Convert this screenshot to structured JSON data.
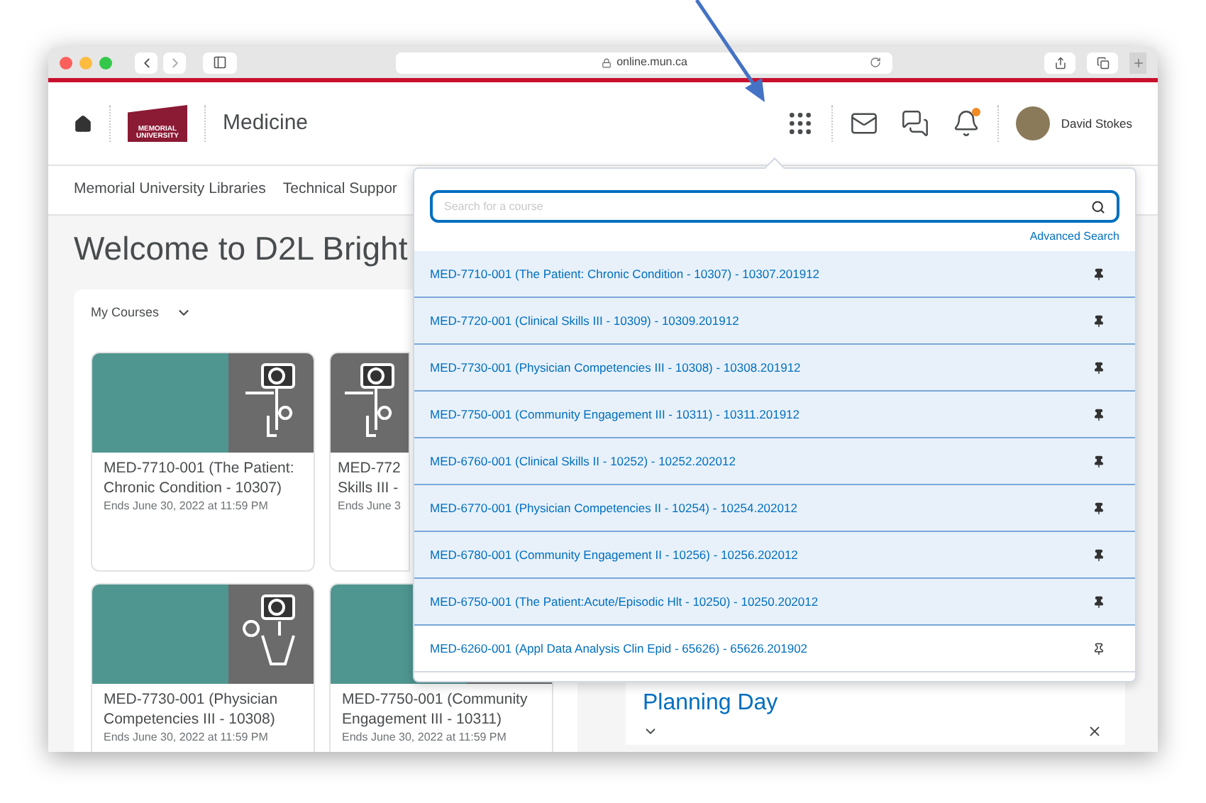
{
  "browser": {
    "url": "online.mun.ca"
  },
  "header": {
    "logo_text": [
      "MEMORIAL",
      "UNIVERSITY"
    ],
    "title": "Medicine",
    "has_new_notifications": true,
    "user": "David Stokes"
  },
  "nav": [
    "Memorial University Libraries",
    "Technical Suppor"
  ],
  "welcome": "Welcome to D2L Bright",
  "my_courses": {
    "label": "My Courses",
    "rows": [
      [
        {
          "title": "MED-7710-001 (The Patient: Chronic Condition - 10307)",
          "ends": "Ends June 30, 2022 at 11:59 PM",
          "partial": false
        },
        {
          "title": "MED-772\nSkills III -",
          "ends": "Ends June 3",
          "partial": true
        }
      ],
      [
        {
          "title": "MED-7730-001 (Physician Competencies III - 10308)",
          "ends": "Ends June 30, 2022 at 11:59 PM",
          "partial": false
        },
        {
          "title": "MED-7750-001 (Community Engagement III - 10311)",
          "ends": "Ends June 30, 2022 at 11:59 PM",
          "partial": false
        }
      ]
    ]
  },
  "course_selector": {
    "placeholder": "Search for a course",
    "advanced_search": "Advanced Search",
    "courses": [
      {
        "label": "MED-7710-001 (The Patient: Chronic Condition - 10307) - 10307.201912",
        "pinned": true
      },
      {
        "label": "MED-7720-001 (Clinical Skills III - 10309) - 10309.201912",
        "pinned": true
      },
      {
        "label": "MED-7730-001 (Physician Competencies III - 10308) - 10308.201912",
        "pinned": true
      },
      {
        "label": "MED-7750-001 (Community Engagement III - 10311) - 10311.201912",
        "pinned": true
      },
      {
        "label": "MED-6760-001 (Clinical Skills II - 10252) - 10252.202012",
        "pinned": true
      },
      {
        "label": "MED-6770-001 (Physician Competencies II - 10254) - 10254.202012",
        "pinned": true
      },
      {
        "label": "MED-6780-001 (Community Engagement II - 10256) - 10256.202012",
        "pinned": true
      },
      {
        "label": "MED-6750-001 (The Patient:Acute/Episodic Hlt - 10250) - 10250.202012",
        "pinned": true
      },
      {
        "label": "MED-6260-001 (Appl Data Analysis Clin Epid - 65626) - 65626.201902",
        "pinned": false
      }
    ]
  },
  "announcement": {
    "title": "Planning Day"
  }
}
